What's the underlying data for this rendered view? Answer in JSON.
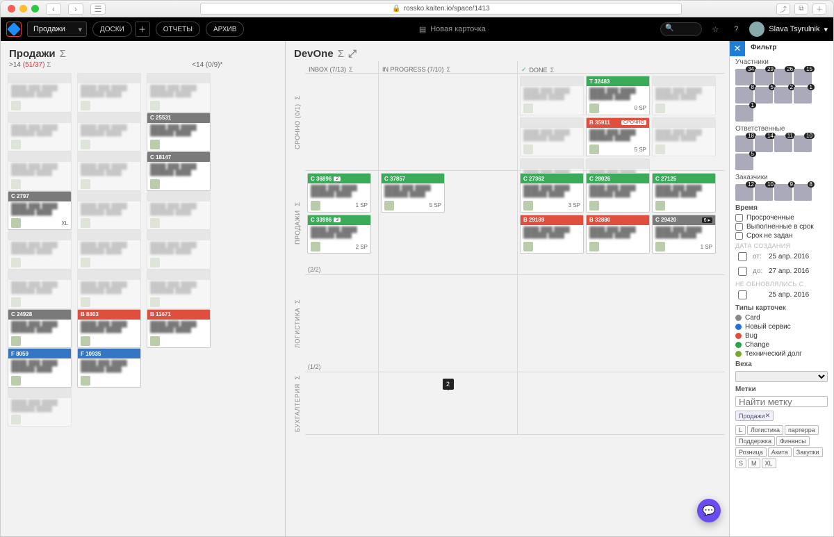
{
  "browser": {
    "url": "rossko.kaiten.io/space/1413"
  },
  "topbar": {
    "space": "Продажи",
    "boards": "ДОСКИ",
    "reports": "ОТЧЕТЫ",
    "archive": "АРХИВ",
    "new_card": "Новая карточка",
    "user": "Slava Tsyrulnik"
  },
  "left": {
    "title": "Продажи",
    "wip_a": ">14",
    "wip_b": "(51/37)",
    "wip_c": "<14 (0/9)*",
    "cols": [
      "",
      "",
      ""
    ],
    "cards": [
      {
        "h": "gray",
        "id": "C 25531",
        "sp": "",
        "body": true
      },
      {
        "h": "gray",
        "id": "C 18147",
        "sp": "",
        "body": true
      },
      {
        "h": "gray",
        "id": "C 2797",
        "sp": "XL",
        "body": true
      },
      {
        "h": "gray",
        "id": "C 24928",
        "sp": ""
      },
      {
        "h": "red2",
        "id": "B 8803",
        "sp": ""
      },
      {
        "h": "blue",
        "id": "F 8059",
        "sp": ""
      },
      {
        "h": "blue",
        "id": "F 10935",
        "sp": ""
      },
      {
        "h": "red2",
        "id": "B 11671",
        "sp": ""
      }
    ]
  },
  "right": {
    "title": "DevOne",
    "col_inbox": "INBOX (7/13)",
    "col_inprog": "IN PROGRESS (7/10)",
    "col_done": "DONE",
    "lanes": [
      "СРОЧНО (0/1)",
      "ПРОДАЖИ",
      "ЛОГИСТИКА",
      "БУХГАЛТЕРИЯ"
    ],
    "row_counts": [
      "(2/2)",
      "(1/2)"
    ],
    "milestone": "2",
    "cards": {
      "done_top": [
        {
          "h": "green",
          "id": "T 32483",
          "sp": "0 SP"
        },
        {
          "h": "red2",
          "id": "B 35911",
          "urg": "СРОЧНО",
          "sp": "5 SP"
        }
      ],
      "sales_inbox": [
        {
          "h": "green",
          "id": "C 36896",
          "badge": "2",
          "sp": "1 SP"
        },
        {
          "h": "green",
          "id": "C 33986",
          "badge": "3",
          "sp": "2 SP"
        }
      ],
      "sales_prog": [
        {
          "h": "green",
          "id": "C 37857",
          "sp": "5 SP"
        }
      ],
      "sales_done": [
        {
          "h": "green",
          "id": "C 27362",
          "sp": "3 SP"
        },
        {
          "h": "green",
          "id": "C 28026",
          "sp": ""
        },
        {
          "h": "green",
          "id": "C 27125",
          "sp": ""
        },
        {
          "h": "red2",
          "id": "B 29189",
          "sp": ""
        },
        {
          "h": "red2",
          "id": "B 32880",
          "sp": ""
        },
        {
          "h": "gray",
          "id": "C 29420",
          "sp": "1 SP",
          "flag": "6"
        }
      ]
    }
  },
  "filter": {
    "title": "Фильтр",
    "members": "Участники",
    "member_counts": [
      "34",
      "29",
      "26",
      "15",
      "8",
      "5",
      "2",
      "1",
      "1"
    ],
    "responsible": "Ответственные",
    "responsible_counts": [
      "18",
      "14",
      "11",
      "10",
      "5"
    ],
    "customers": "Заказчики",
    "customer_counts": [
      "12",
      "10",
      "9",
      "8"
    ],
    "time_head": "Время",
    "overdue": "Просроченные",
    "ontime": "Выполненные в срок",
    "nodue": "Срок не задан",
    "created_head": "ДАТА СОЗДАНИЯ",
    "from_lbl": "от:",
    "from": "25 апр. 2016",
    "to_lbl": "до:",
    "to": "27 апр. 2016",
    "noupdate_head": "НЕ ОБНОВЛЯЛИСЬ С",
    "noupdate": "25 апр. 2016",
    "types_head": "Типы карточек",
    "types": [
      {
        "c": "#888",
        "n": "Card"
      },
      {
        "c": "#1f6fe0",
        "n": "Новый сервис"
      },
      {
        "c": "#e04e3e",
        "n": "Bug"
      },
      {
        "c": "#2fa24a",
        "n": "Change"
      },
      {
        "c": "#7aa82f",
        "n": "Технический долг"
      }
    ],
    "milestone_head": "Веха",
    "tags_head": "Метки",
    "find_tag": "Найти метку",
    "selected_tag": "Продажи",
    "tags": [
      "L",
      "Логистика",
      "партерра",
      "Поддержка",
      "Финансы",
      "Розница",
      "Акита",
      "Закупки",
      "S",
      "M",
      "XL"
    ]
  }
}
